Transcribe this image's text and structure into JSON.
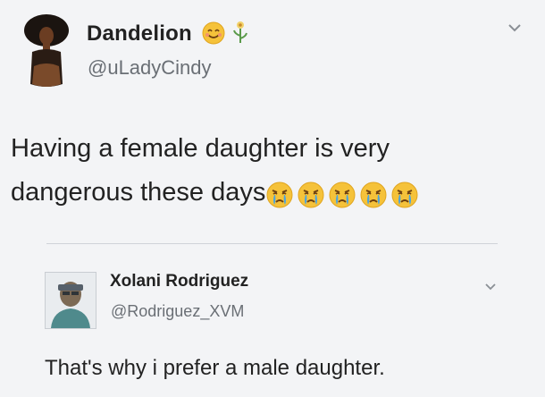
{
  "tweet": {
    "author": {
      "name": "Dandelion",
      "handle": "@uLadyCindy",
      "name_emojis": [
        "smiling-face-emoji",
        "flower-emoji"
      ]
    },
    "text": "Having a female daughter is very dangerous these days",
    "trailing_emojis": [
      "crying-face-emoji",
      "crying-face-emoji",
      "crying-face-emoji",
      "crying-face-emoji",
      "crying-face-emoji"
    ]
  },
  "reply": {
    "author": {
      "name": "Xolani Rodriguez",
      "handle": "@Rodriguez_XVM"
    },
    "text": "That's why i prefer a male daughter."
  },
  "colors": {
    "background": "#f3f4f6",
    "text": "#222222",
    "handle": "#6a6f75",
    "emoji_yellow": "#f5c23a"
  }
}
